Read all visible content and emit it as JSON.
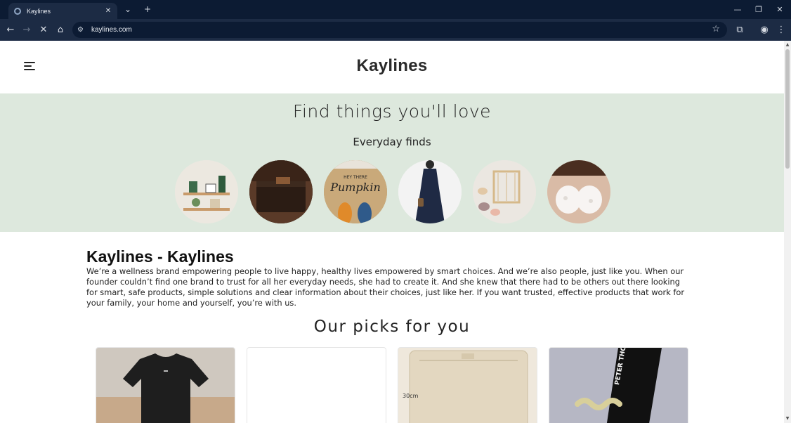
{
  "browser": {
    "tab_title": "Kaylines",
    "url": "kaylines.com",
    "icons": [
      "favicon-icon",
      "close-icon",
      "chevron-down-icon",
      "plus-icon",
      "back-icon",
      "forward-icon",
      "stop-icon",
      "home-icon",
      "site-info-icon",
      "star-icon",
      "extensions-icon",
      "profile-icon",
      "menu-icon",
      "minimize-icon",
      "restore-icon"
    ]
  },
  "header": {
    "logo": "Kaylines"
  },
  "hero": {
    "title": "Find things you'll love",
    "subtitle": "Everyday finds",
    "categories": [
      "shelf-decor",
      "wallet",
      "doormat-pumpkin",
      "dress",
      "weaving-loom",
      "lace-bra"
    ]
  },
  "about": {
    "title": "Kaylines - Kaylines",
    "text": "We’re a wellness brand empowering people to live happy, healthy lives empowered by smart choices. And we’re also people, just like you. When our founder couldn’t find one brand to trust for all her everyday needs, she had to create it. And she knew that there had to be others out there looking for smart, safe products, simple solutions and clear information about their choices, just like her. If you want trusted, effective products that work for your family, your home and yourself, you’re with us."
  },
  "picks": {
    "title": "Our picks for you",
    "cards": [
      "black-tshirt",
      "empty",
      "storage-bag",
      "peter-thomas-roth-tube"
    ],
    "storage_label": "30cm",
    "tube_text": "PETER THOMAS ROTH"
  },
  "colors": {
    "hero_bg": "#dde8dd",
    "chrome_dark": "#0c1b33",
    "chrome_mid": "#1c2b44"
  }
}
